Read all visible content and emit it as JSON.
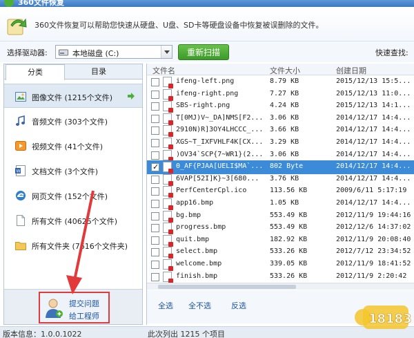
{
  "window": {
    "title": "360文件恢复"
  },
  "header": {
    "description": "360文件恢复可以帮助您快速从硬盘、U盘、SD卡等硬盘设备中恢复被误删除的文件。"
  },
  "toolbar": {
    "drive_label": "选择驱动器:",
    "drive_value": "本地磁盘 (C:)",
    "rescan_label": "重新扫描",
    "quick_search_label": "快速查找:"
  },
  "left_tabs": [
    {
      "label": "分类"
    },
    {
      "label": "目录"
    }
  ],
  "categories": [
    {
      "label": "图像文件 (1215个文件)",
      "icon": "image-icon"
    },
    {
      "label": "音频文件 (303个文件)",
      "icon": "music-icon"
    },
    {
      "label": "视频文件 (41个文件)",
      "icon": "video-icon"
    },
    {
      "label": "文档文件 (3个文件)",
      "icon": "document-icon"
    },
    {
      "label": "网页文件 (152个文件)",
      "icon": "webpage-icon"
    },
    {
      "label": "所有文件 (40625个文件)",
      "icon": "file-icon"
    },
    {
      "label": "所有文件夹 (7616个文件夹)",
      "icon": "folder-icon"
    }
  ],
  "submit_issue": {
    "line1": "提交问题",
    "line2": "给工程师"
  },
  "columns": {
    "name": "文件名",
    "size": "文件大小",
    "date": "创建日期"
  },
  "files": [
    {
      "name": "ifeng-left.png",
      "size": "8.79 KB",
      "date": "2015/12/13 15:5...",
      "checked": false,
      "selected": false
    },
    {
      "name": "ifeng-right.png",
      "size": "7.27 KB",
      "date": "2015/12/13 11:0...",
      "checked": false,
      "selected": false
    },
    {
      "name": "SBS-right.png",
      "size": "4.24 KB",
      "date": "2015/12/13 14:1...",
      "checked": false,
      "selected": false
    },
    {
      "name": "T[0MJ)V~_DA]NMS[F2...",
      "size": "3.06 KB",
      "date": "2014/12/17 14:4...",
      "checked": false,
      "selected": false
    },
    {
      "name": "2910N)R]3OY4LHCCC_...",
      "size": "3.66 KB",
      "date": "2014/12/17 14:4...",
      "checked": false,
      "selected": false
    },
    {
      "name": "XGS~T_IXFVHLF4K[CX...",
      "size": "3.29 KB",
      "date": "2014/12/17 14:4...",
      "checked": false,
      "selected": false
    },
    {
      "name": ")OV34`SCP{7~WR1}(2...",
      "size": "3.06 KB",
      "date": "2014/12/17 14:4...",
      "checked": false,
      "selected": false
    },
    {
      "name": "0_AF{PJAA[UELI$MA`...",
      "size": "802 Byte",
      "date": "2014/12/17 14:4...",
      "checked": true,
      "selected": true
    },
    {
      "name": "6VAP[52I]K}~3[680...",
      "size": "3.76 KB",
      "date": "2014/12/17 14:4...",
      "checked": false,
      "selected": false
    },
    {
      "name": "PerfCenterCpl.ico",
      "size": "113.56 KB",
      "date": "2009/6/11 5:17:19",
      "checked": false,
      "selected": false
    },
    {
      "name": "app16.bmp",
      "size": "1.05 KB",
      "date": "2014/12/17 14:4...",
      "checked": false,
      "selected": false
    },
    {
      "name": "bg.bmp",
      "size": "553.49 KB",
      "date": "2012/11/9 19:44:16",
      "checked": false,
      "selected": false
    },
    {
      "name": "progress.bmp",
      "size": "553.49 KB",
      "date": "2012/12/6 14:37:02",
      "checked": false,
      "selected": false
    },
    {
      "name": "quit.bmp",
      "size": "182.92 KB",
      "date": "2012/11/9 20:08:40",
      "checked": false,
      "selected": false
    },
    {
      "name": "select.bmp",
      "size": "533.26 KB",
      "date": "2012/7/12 23:34:52",
      "checked": false,
      "selected": false
    },
    {
      "name": "welcome.bmp",
      "size": "339.05 KB",
      "date": "2012/11/9 18:41:52",
      "checked": false,
      "selected": false
    },
    {
      "name": "finish.bmp",
      "size": "533.26 KB",
      "date": "2012/11/9 2:20:42",
      "checked": false,
      "selected": false
    }
  ],
  "actions": {
    "select_all": "全选",
    "select_none": "全不选",
    "invert": "反选"
  },
  "status": {
    "version": "版本信息：1.0.0.1022",
    "scan_result": "此次列出 1215 个项目"
  },
  "colors": {
    "selected_row": "#3b8bd8",
    "scan_button": "#4caf38",
    "annotation": "#e23a3a"
  },
  "watermark": {
    "text": "18183"
  }
}
